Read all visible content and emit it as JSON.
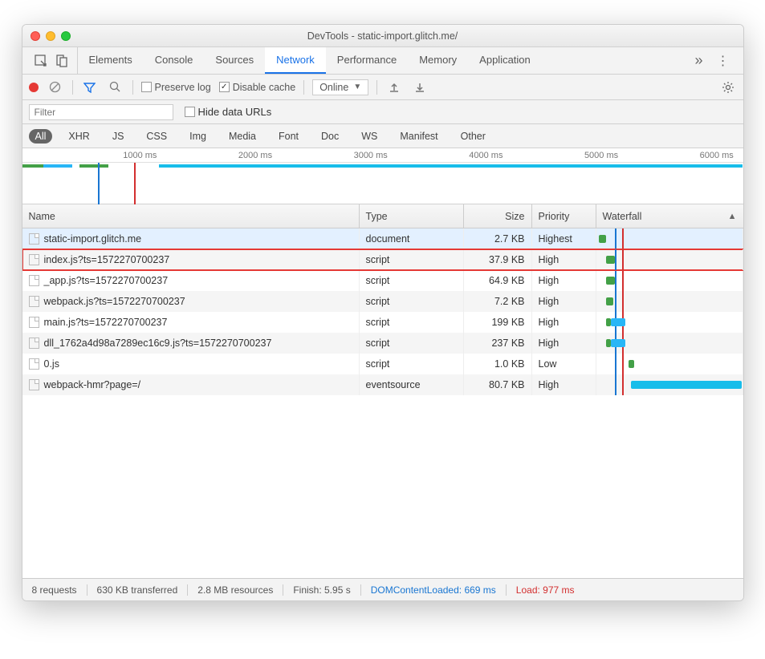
{
  "window_title": "DevTools - static-import.glitch.me/",
  "tabs": [
    "Elements",
    "Console",
    "Sources",
    "Network",
    "Performance",
    "Memory",
    "Application"
  ],
  "active_tab": "Network",
  "toolbar": {
    "preserve_log": "Preserve log",
    "disable_cache": "Disable cache",
    "online": "Online"
  },
  "filter": {
    "placeholder": "Filter",
    "hide_data_urls": "Hide data URLs"
  },
  "type_filters": [
    "All",
    "XHR",
    "JS",
    "CSS",
    "Img",
    "Media",
    "Font",
    "Doc",
    "WS",
    "Manifest",
    "Other"
  ],
  "timeline_ticks": [
    "1000 ms",
    "2000 ms",
    "3000 ms",
    "4000 ms",
    "5000 ms",
    "6000 ms"
  ],
  "columns": {
    "name": "Name",
    "type": "Type",
    "size": "Size",
    "priority": "Priority",
    "waterfall": "Waterfall"
  },
  "rows": [
    {
      "name": "static-import.glitch.me",
      "type": "document",
      "size": "2.7 KB",
      "priority": "Highest"
    },
    {
      "name": "index.js?ts=1572270700237",
      "type": "script",
      "size": "37.9 KB",
      "priority": "High"
    },
    {
      "name": "_app.js?ts=1572270700237",
      "type": "script",
      "size": "64.9 KB",
      "priority": "High"
    },
    {
      "name": "webpack.js?ts=1572270700237",
      "type": "script",
      "size": "7.2 KB",
      "priority": "High"
    },
    {
      "name": "main.js?ts=1572270700237",
      "type": "script",
      "size": "199 KB",
      "priority": "High"
    },
    {
      "name": "dll_1762a4d98a7289ec16c9.js?ts=1572270700237",
      "type": "script",
      "size": "237 KB",
      "priority": "High"
    },
    {
      "name": "0.js",
      "type": "script",
      "size": "1.0 KB",
      "priority": "Low"
    },
    {
      "name": "webpack-hmr?page=/",
      "type": "eventsource",
      "size": "80.7 KB",
      "priority": "High"
    }
  ],
  "status": {
    "requests": "8 requests",
    "transferred": "630 KB transferred",
    "resources": "2.8 MB resources",
    "finish": "Finish: 5.95 s",
    "domloaded": "DOMContentLoaded: 669 ms",
    "load": "Load: 977 ms"
  }
}
